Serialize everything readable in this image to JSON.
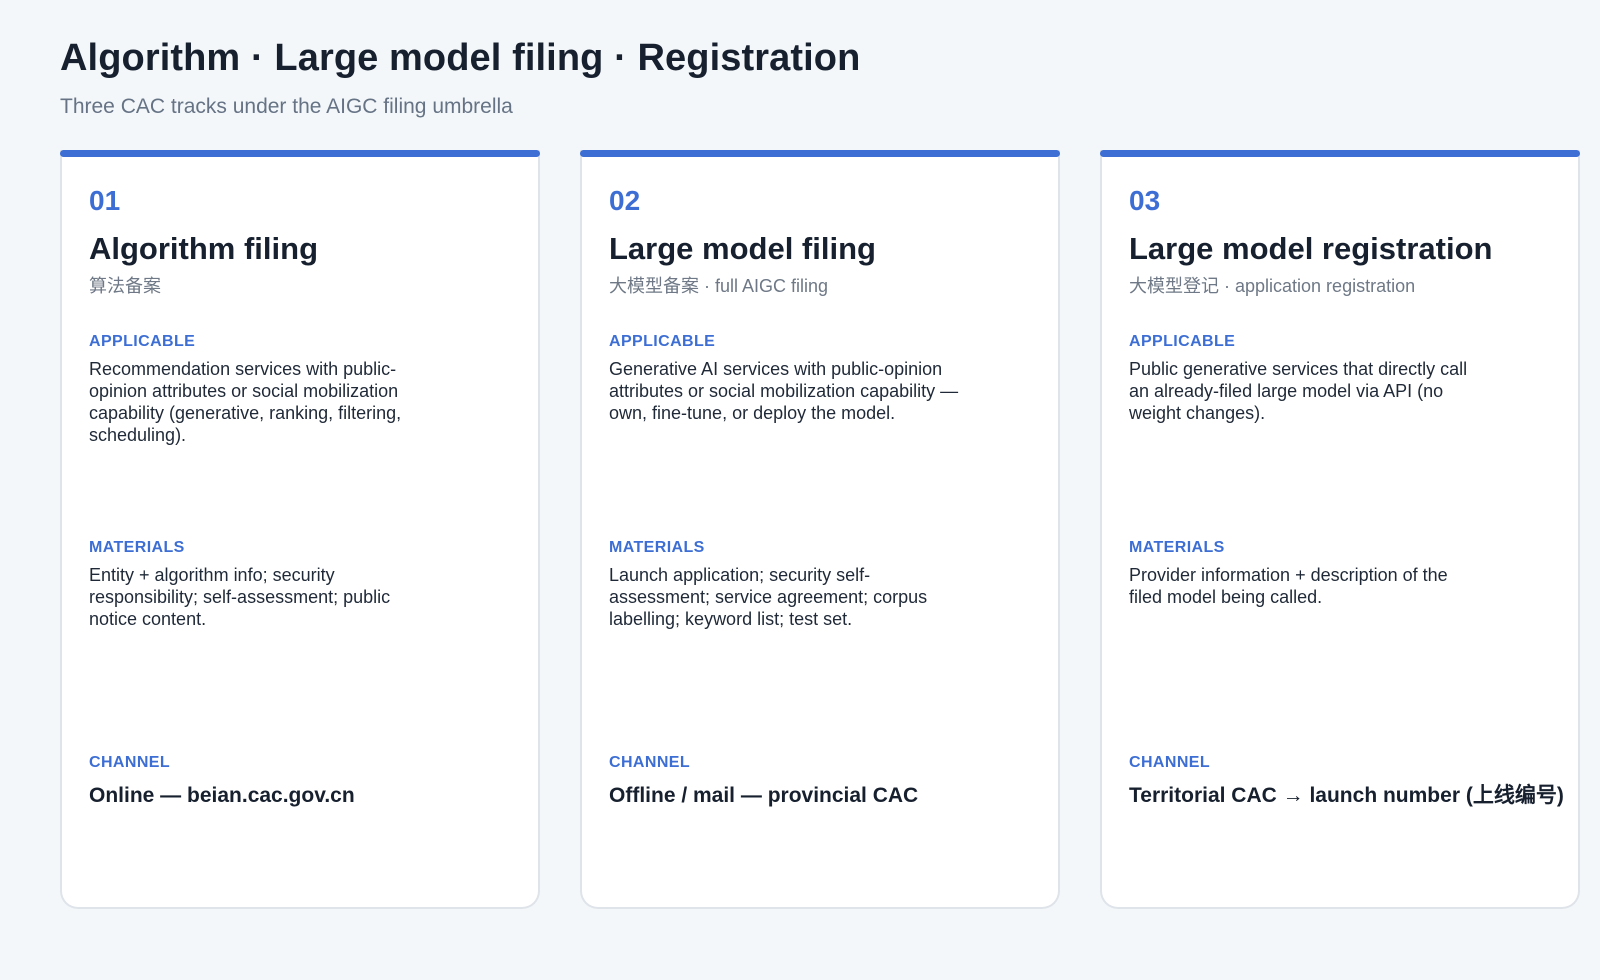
{
  "header": {
    "title": "Algorithm · Large model filing · Registration",
    "subtitle": "Three CAC tracks under the AIGC filing umbrella"
  },
  "cards": [
    {
      "number": "01",
      "title": "Algorithm filing",
      "subtitle": "算法备案",
      "applicable_label": "APPLICABLE",
      "applicable_text": "Recommendation services with public-opinion attributes or social mobilization capability (generative, ranking, filtering, scheduling).",
      "materials_label": "MATERIALS",
      "materials_text": "Entity + algorithm info; security responsibility; self-assessment; public notice content.",
      "channel_label": "CHANNEL",
      "channel_value": "Online — beian.cac.gov.cn"
    },
    {
      "number": "02",
      "title": "Large model filing",
      "subtitle": "大模型备案 · full AIGC filing",
      "applicable_label": "APPLICABLE",
      "applicable_text": "Generative AI services with public-opinion attributes or social mobilization capability — own, fine-tune, or deploy the model.",
      "materials_label": "MATERIALS",
      "materials_text": "Launch application; security self-assessment; service agreement; corpus labelling; keyword list; test set.",
      "channel_label": "CHANNEL",
      "channel_value": "Offline / mail — provincial CAC"
    },
    {
      "number": "03",
      "title": "Large model registration",
      "subtitle": "大模型登记 · application registration",
      "applicable_label": "APPLICABLE",
      "applicable_text": "Public generative services that directly call an already-filed large model via API (no weight changes).",
      "materials_label": "MATERIALS",
      "materials_text": "Provider information + description of the filed model being called.",
      "channel_label": "CHANNEL",
      "channel_value": "Territorial CAC → launch number (上线编号)"
    }
  ],
  "colors": {
    "background": "#f3f7fa",
    "accent": "#3d6ed4",
    "card_background": "#ffffff",
    "card_border": "#dfe4ea",
    "title_text": "#17202e",
    "muted_text": "#667385"
  }
}
